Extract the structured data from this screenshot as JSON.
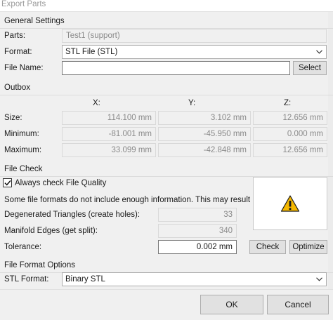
{
  "window": {
    "title": "Export Parts"
  },
  "general": {
    "title": "General Settings",
    "parts_label": "Parts:",
    "parts_value": "Test1 (support)",
    "format_label": "Format:",
    "format_value": "STL File (STL)",
    "filename_label": "File Name:",
    "filename_value": "",
    "select_button": "Select"
  },
  "outbox": {
    "title": "Outbox",
    "axes": [
      "X:",
      "Y:",
      "Z:"
    ],
    "rows": [
      {
        "label": "Size:",
        "x": "114.100 mm",
        "y": "3.102 mm",
        "z": "12.656 mm"
      },
      {
        "label": "Minimum:",
        "x": "-81.001 mm",
        "y": "-45.950 mm",
        "z": "0.000 mm"
      },
      {
        "label": "Maximum:",
        "x": "33.099 mm",
        "y": "-42.848 mm",
        "z": "12.656 mm"
      }
    ]
  },
  "filecheck": {
    "title": "File Check",
    "always_check_label": "Always check File Quality",
    "always_check_checked": true,
    "message": "Some file formats do not include enough information. This may result in errors.",
    "degenerated_label": "Degenerated Triangles (create holes):",
    "degenerated_value": "33",
    "manifold_label": "Manifold Edges (get split):",
    "manifold_value": "340",
    "tolerance_label": "Tolerance:",
    "tolerance_value": "0.002 mm",
    "check_button": "Check",
    "optimize_button": "Optimize",
    "warning_icon": "warning-icon"
  },
  "formatopts": {
    "title": "File Format Options",
    "stl_format_label": "STL Format:",
    "stl_format_value": "Binary STL"
  },
  "footer": {
    "ok_button": "OK",
    "cancel_button": "Cancel"
  },
  "colors": {
    "warning_fill": "#f5b800",
    "warning_stroke": "#1a1a1a",
    "dialog_bg": "#f0f0f0"
  }
}
